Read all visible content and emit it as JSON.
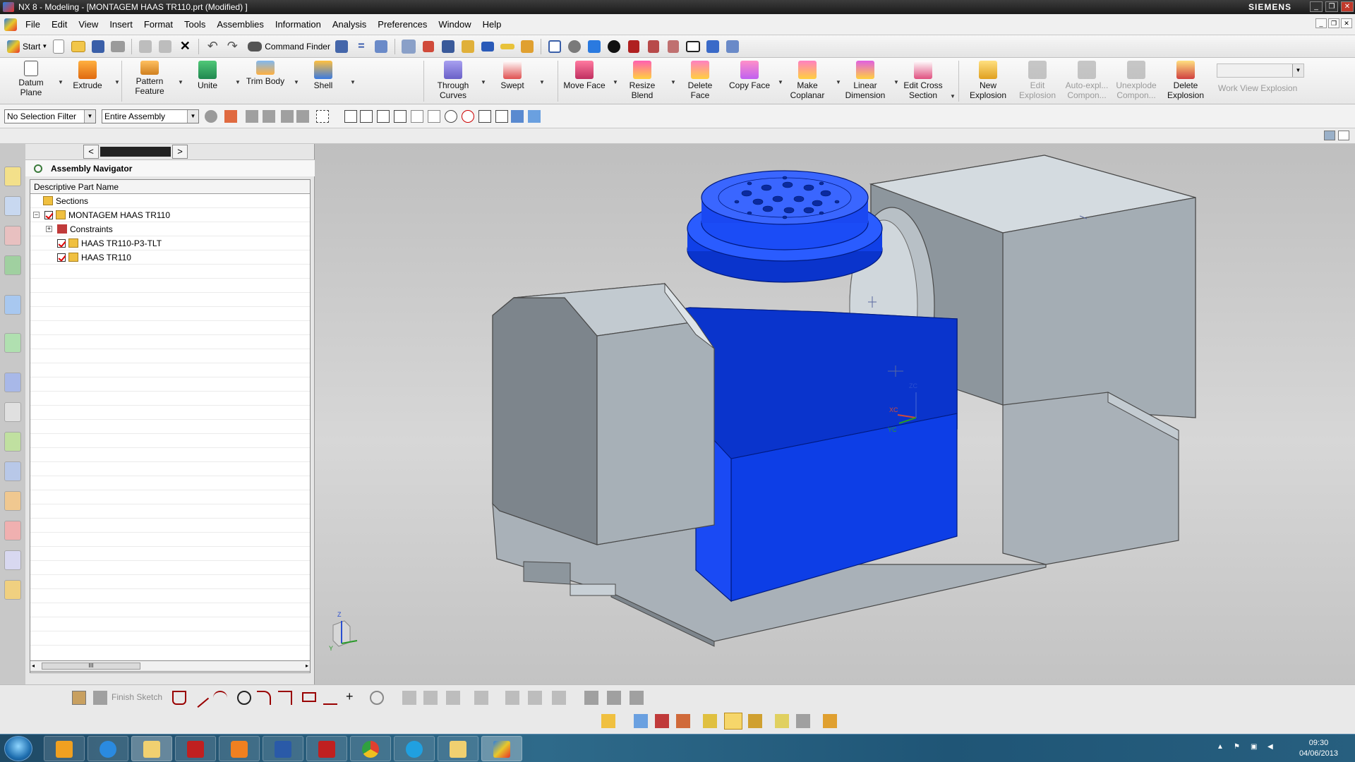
{
  "window": {
    "title": "NX 8 - Modeling - [MONTAGEM HAAS TR110.prt (Modified) ]",
    "brand": "SIEMENS"
  },
  "menu": [
    "File",
    "Edit",
    "View",
    "Insert",
    "Format",
    "Tools",
    "Assemblies",
    "Information",
    "Analysis",
    "Preferences",
    "Window",
    "Help"
  ],
  "standard_toolbar": {
    "start_label": "Start",
    "command_finder_label": "Command Finder"
  },
  "ribbon": {
    "items": [
      {
        "label1": "Datum",
        "label2": "Plane"
      },
      {
        "label1": "Extrude",
        "label2": ""
      },
      {
        "label1": "Pattern",
        "label2": "Feature"
      },
      {
        "label1": "Unite",
        "label2": ""
      },
      {
        "label1": "Trim Body",
        "label2": ""
      },
      {
        "label1": "Shell",
        "label2": ""
      },
      {
        "label1": "Through",
        "label2": "Curves"
      },
      {
        "label1": "Swept",
        "label2": ""
      },
      {
        "label1": "Move Face",
        "label2": ""
      },
      {
        "label1": "Resize",
        "label2": "Blend"
      },
      {
        "label1": "Delete",
        "label2": "Face"
      },
      {
        "label1": "Copy Face",
        "label2": ""
      },
      {
        "label1": "Make",
        "label2": "Coplanar"
      },
      {
        "label1": "Linear",
        "label2": "Dimension"
      },
      {
        "label1": "Edit Cross",
        "label2": "Section"
      },
      {
        "label1": "New",
        "label2": "Explosion"
      },
      {
        "label1": "Edit",
        "label2": "Explosion"
      },
      {
        "label1": "Auto-expl...",
        "label2": "Compon..."
      },
      {
        "label1": "Unexplode",
        "label2": "Compon..."
      },
      {
        "label1": "Delete",
        "label2": "Explosion"
      }
    ],
    "work_view_explosion_label": "Work View Explosion"
  },
  "selection_bar": {
    "filter_value": "No Selection Filter",
    "scope_value": "Entire Assembly"
  },
  "navigator": {
    "title": "Assembly Navigator",
    "column_header": "Descriptive Part Name",
    "tree": [
      {
        "label": "Sections"
      },
      {
        "label": "MONTAGEM HAAS TR110"
      },
      {
        "label": "Constraints"
      },
      {
        "label": "HAAS TR110-P3-TLT"
      },
      {
        "label": "HAAS TR110"
      }
    ],
    "scroll_thumb": "III"
  },
  "viewport": {
    "triad_z": "Z",
    "triad_y": "Y",
    "csys_zc": "ZC",
    "csys_xc": "XC",
    "csys_yc": "YC",
    "colors": {
      "grey_part": "#a9b1b8",
      "grey_light": "#c8d0d6",
      "grey_dark": "#7d858c",
      "blue_part": "#1040e8",
      "blue_dark": "#0830b8",
      "blue_light": "#2a5cff"
    }
  },
  "sketch_toolbar": {
    "finish_sketch_label": "Finish Sketch"
  },
  "taskbar": {
    "time": "09:30",
    "date": "04/06/2013"
  }
}
